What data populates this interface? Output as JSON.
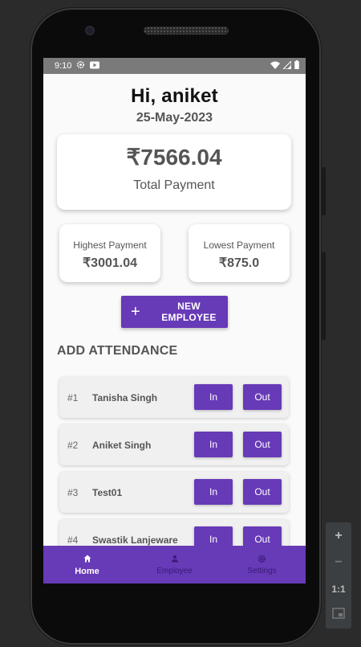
{
  "status": {
    "time": "9:10"
  },
  "header": {
    "greeting": "Hi, aniket",
    "date": "25-May-2023"
  },
  "summary": {
    "total_amount": "₹7566.04",
    "total_label": "Total Payment",
    "highest_label": "Highest Payment",
    "highest_amount": "₹3001.04",
    "lowest_label": "Lowest Payment",
    "lowest_amount": "₹875.0"
  },
  "actions": {
    "new_employee_label": "NEW EMPLOYEE"
  },
  "attendance": {
    "title": "ADD ATTENDANCE",
    "in_label": "In",
    "out_label": "Out",
    "employees": [
      {
        "num": "#1",
        "name": "Tanisha Singh"
      },
      {
        "num": "#2",
        "name": "Aniket Singh"
      },
      {
        "num": "#3",
        "name": "Test01"
      },
      {
        "num": "#4",
        "name": "Swastik Lanjeware"
      }
    ]
  },
  "nav": {
    "home": "Home",
    "employee": "Employee",
    "settings": "Settings"
  },
  "emulator": {
    "zoom_in": "+",
    "zoom_out": "−",
    "one_to_one": "1:1"
  },
  "colors": {
    "primary": "#673ab7",
    "status_bar": "#7a7a7a",
    "background": "#fafafa"
  }
}
